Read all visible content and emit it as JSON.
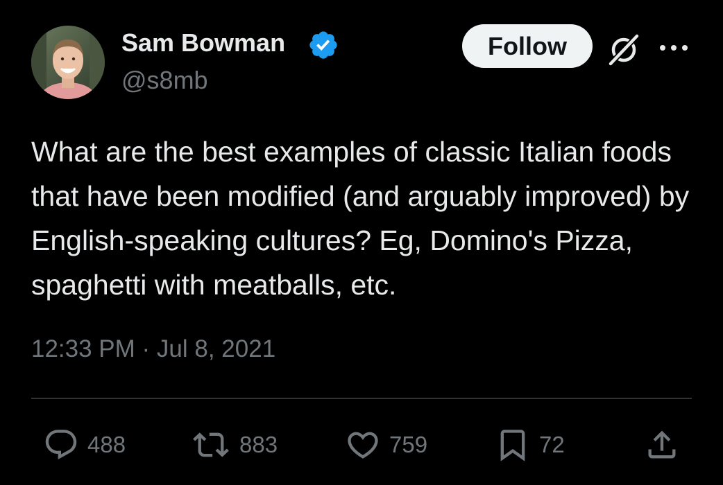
{
  "author": {
    "display_name": "Sam Bowman",
    "handle": "@s8mb",
    "verified_icon": "verified-badge-icon",
    "verified_color": "#1d9bf0"
  },
  "header": {
    "follow_label": "Follow",
    "grok_icon": "grok-icon",
    "more_icon": "more-options-icon"
  },
  "tweet": {
    "text": "What are the best examples of classic Italian foods that have been modified (and arguably improved) by English-speaking cultures? Eg, Domino's Pizza, spaghetti with meatballs, etc.",
    "timestamp": "12:33 PM · Jul 8, 2021"
  },
  "actions": {
    "replies": {
      "icon": "reply-icon",
      "count": "488"
    },
    "reposts": {
      "icon": "repost-icon",
      "count": "883"
    },
    "likes": {
      "icon": "like-icon",
      "count": "759"
    },
    "bookmarks": {
      "icon": "bookmark-icon",
      "count": "72"
    },
    "share": {
      "icon": "share-icon"
    }
  },
  "colors": {
    "background": "#000000",
    "primary_text": "#e7e9ea",
    "secondary_text": "#71767b",
    "divider": "#2f3336"
  }
}
